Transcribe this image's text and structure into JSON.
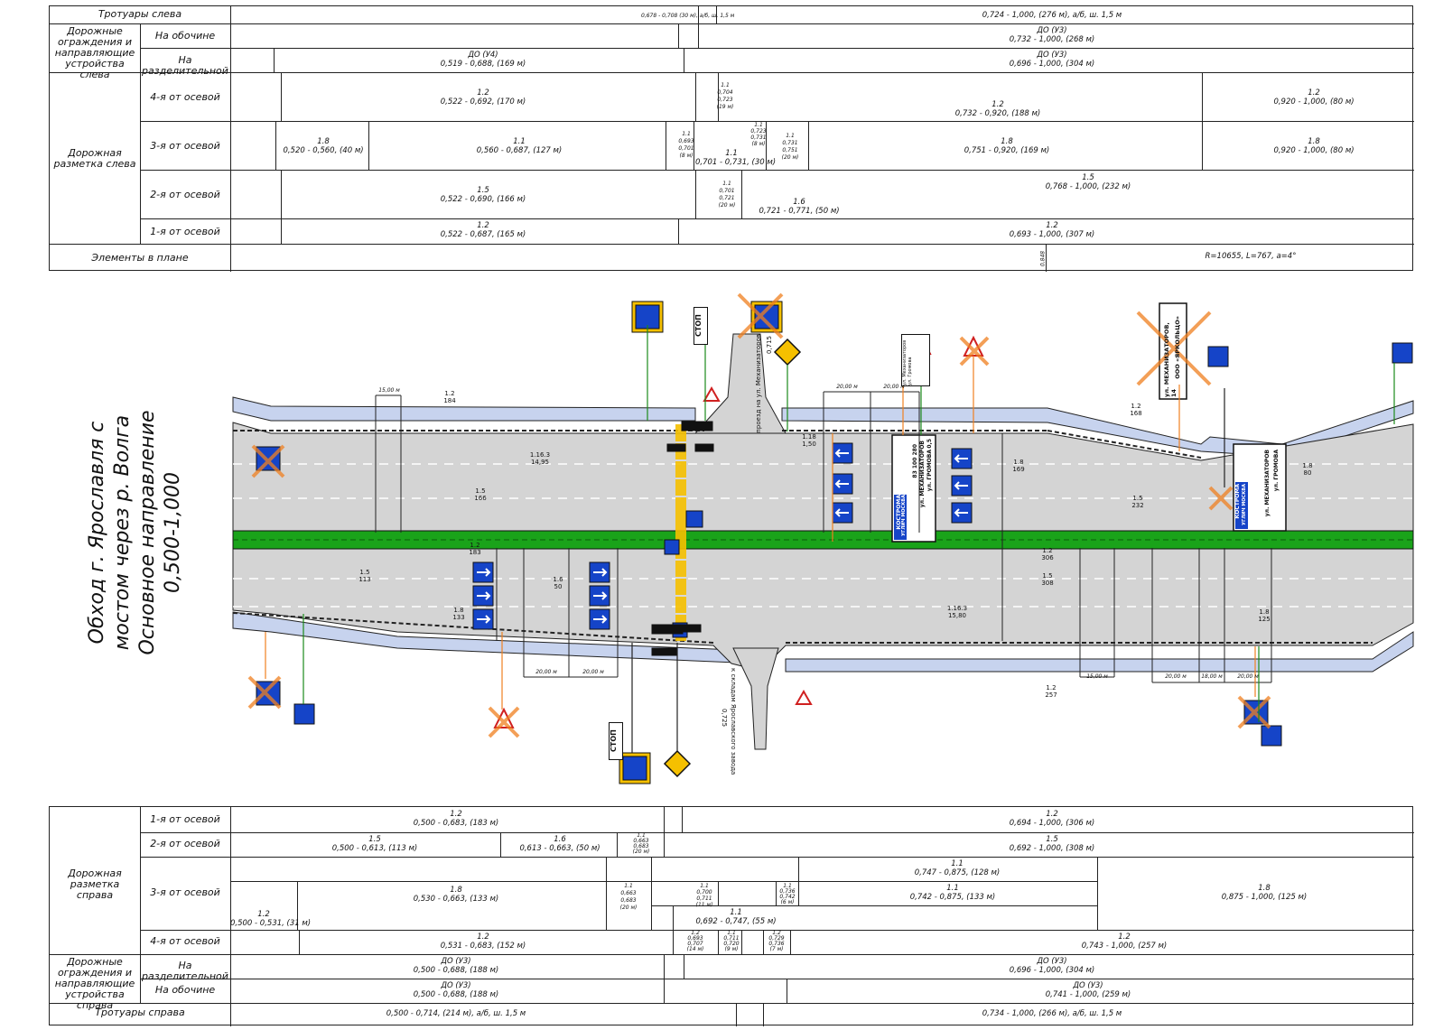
{
  "title": {
    "line1": "Обход г. Ярославля с мостом через р. Волга",
    "line2": "Основное направление",
    "line3": "0,500-1,000"
  },
  "top_table": {
    "sidewalks_left": "Тротуары слева",
    "barriers_left": "Дорожные ограждения и направляющие устройства слева",
    "shoulder": "На обочине",
    "median": "На разделительной",
    "marking_left": "Дорожная разметка слева",
    "lane4": "4-я от осевой",
    "lane3": "3-я от осевой",
    "lane2": "2-я от осевой",
    "lane1": "1-я от осевой",
    "plan_elements": "Элементы в плане",
    "sw_small": "0,678 - 0,708 (30 м), а/б, ш. 1,5 м",
    "sw_main": "0,724 - 1,000, (276 м), а/б, ш. 1,5 м",
    "sh_code": "ДО (У3)",
    "sh_val": "0,732 - 1,000, (268 м)",
    "md1_code": "ДО (У4)",
    "md1_val": "0,519 - 0,688, (169 м)",
    "md2_code": "ДО (У3)",
    "md2_val": "0,696 - 1,000, (304 м)",
    "l4a_code": "1.2",
    "l4a_val": "0,522 - 0,692, (170 м)",
    "l4b_code": "1.1",
    "l4b_v1": "0,704",
    "l4b_v2": "0,723",
    "l4b_v3": "(19 м)",
    "l4c_code": "1.2",
    "l4c_val": "0,732 - 0,920, (188 м)",
    "l4d_code": "1.2",
    "l4d_val": "0,920 - 1,000, (80 м)",
    "l3a_code": "1.8",
    "l3a_val": "0,520 - 0,560, (40 м)",
    "l3b_code": "1.1",
    "l3b_val": "0,560 - 0,687, (127 м)",
    "l3c_code": "1.1",
    "l3c_v1": "0,693",
    "l3c_v2": "0,701",
    "l3c_v3": "(8 м)",
    "l3d_code": "1.1",
    "l3d_val": "0,701 - 0,731, (30 м)",
    "l3e_code": "1.1",
    "l3e_v1": "0,723",
    "l3e_v2": "0,731",
    "l3e_v3": "(8 м)",
    "l3f_code": "1.1",
    "l3f_v1": "0,731",
    "l3f_v2": "0,751",
    "l3f_v3": "(20 м)",
    "l3g_code": "1.8",
    "l3g_val": "0,751 - 0,920, (169 м)",
    "l3h_code": "1.8",
    "l3h_val": "0,920 - 1,000, (80 м)",
    "l2a_code": "1.5",
    "l2a_val": "0,522 - 0,690, (166 м)",
    "l2b_code": "1.1",
    "l2b_v1": "0,701",
    "l2b_v2": "0,721",
    "l2b_v3": "(20 м)",
    "l2c_code": "1.6",
    "l2c_val": "0,721 - 0,771, (50 м)",
    "l2d_code": "1.5",
    "l2d_val": "0,768 - 1,000, (232 м)",
    "l1a_code": "1.2",
    "l1a_val": "0,522 - 0,687, (165 м)",
    "l1b_code": "1.2",
    "l1b_val": "0,693 - 1,000, (307 м)",
    "plan_val": "R=10655, L=767, а=4°",
    "plan_km": "0,848"
  },
  "bottom_table": {
    "marking_right": "Дорожная разметка справа",
    "lane1": "1-я от осевой",
    "lane2": "2-я от осевой",
    "lane3": "3-я от осевой",
    "lane4": "4-я от осевой",
    "barriers_right": "Дорожные ограждения и направляющие устройства справа",
    "median": "На разделительной",
    "shoulder": "На обочине",
    "sidewalks_right": "Тротуары справа",
    "r1a_code": "1.2",
    "r1a_val": "0,500 - 0,683, (183 м)",
    "r1b_code": "1.2",
    "r1b_val": "0,694 - 1,000, (306 м)",
    "r2a_code": "1.5",
    "r2a_val": "0,500 - 0,613, (113 м)",
    "r2b_code": "1.6",
    "r2b_val": "0,613 - 0,663, (50 м)",
    "r2c_code": "1.1",
    "r2c_v1": "0,663",
    "r2c_v2": "0,683",
    "r2c_v3": "(20 м)",
    "r2d_code": "1.5",
    "r2d_val": "0,692 - 1,000, (308 м)",
    "r3a_code": "1.8",
    "r3a_val": "0,530 - 0,663, (133 м)",
    "r3b_code": "1.2",
    "r3b_val": "0,500 - 0,531, (31 м)",
    "r3c_code": "1.1",
    "r3c_v1": "0,663",
    "r3c_v2": "0,683",
    "r3c_v3": "(20 м)",
    "r3d_code": "1.1",
    "r3d_v1": "0,700",
    "r3d_v2": "0,711",
    "r3d_v3": "(11 м)",
    "r3e_code": "1.1",
    "r3e_val": "0,692 - 0,747, (55 м)",
    "r3f_code": "1.1",
    "r3f_v1": "0,736",
    "r3f_v2": "0,742",
    "r3f_v3": "(6 м)",
    "r3g_code": "1.1",
    "r3g_val": "0,747 - 0,875, (128 м)",
    "r3h_code": "1.1",
    "r3h_val": "0,742 - 0,875, (133 м)",
    "r3i_code": "1.8",
    "r3i_val": "0,875 - 1,000, (125 м)",
    "r4a_code": "1.2",
    "r4a_val": "0,531 - 0,683, (152 м)",
    "r4b_code": "1.2",
    "r4b_v1": "0,693",
    "r4b_v2": "0,707",
    "r4b_v3": "(14 м)",
    "r4c_code": "1.1",
    "r4c_v1": "0,711",
    "r4c_v2": "0,720",
    "r4c_v3": "(9 м)",
    "r4d_code": "1.2",
    "r4d_v1": "0,729",
    "r4d_v2": "0,736",
    "r4d_v3": "(7 м)",
    "r4e_code": "1.2",
    "r4e_val": "0,743 - 1,000, (257 м)",
    "bm1_code": "ДО (У3)",
    "bm1_val": "0,500 - 0,688, (188 м)",
    "bm2_code": "ДО (У3)",
    "bm2_val": "0,696 - 1,000, (304 м)",
    "bs1_code": "ДО (У3)",
    "bs1_val": "0,500 - 0,688, (188 м)",
    "bs2_code": "ДО (У3)",
    "bs2_val": "0,741 - 1,000, (259 м)",
    "sw1": "0,500 - 0,714, (214 м), а/б, ш. 1,5 м",
    "sw2": "0,734 - 1,000, (266 м), а/б, ш. 1,5 м"
  },
  "plan": {
    "dist_15_left": "15,00 м",
    "dist_20a": "20,00 м",
    "dist_20b": "20,00 м",
    "dist_20c": "20,00 м",
    "dist_20d": "20,00 м",
    "dist_15_right": "15,00 м",
    "dist_20e": "20,00 м",
    "dist_18": "18,00 м",
    "dist_20f": "20,00 м",
    "stop1": "СТОП",
    "stop2": "СТОП",
    "road_top_label": "проезд на ул. Механизаторов",
    "road_top_km": "0,715",
    "road_bottom_label": "к складам Ярославского завода",
    "road_bottom_km": "0,725",
    "sign_big_1_a": "КОСТРОМА",
    "sign_big_1_b": "УГЛИЧ",
    "sign_big_1_c": "МОСКВА",
    "sign_big_1_d": "ул. МЕХАНИЗАТОРОВ",
    "sign_big_1_e": "ул. ГРОМОВА",
    "sign_big_1_n1": "83",
    "sign_big_1_n2": "100",
    "sign_big_1_n3": "280",
    "sign_big_1_n4": "0,5",
    "sign_big_2_a": "КОСТРОМА",
    "sign_big_2_b": "УГЛИЧ",
    "sign_big_2_c": "МОСКВА",
    "sign_big_2_d": "ул. МЕХАНИЗАТОРОВ",
    "sign_big_2_e": "ул. ГРОМОВА",
    "sign_top_right_a": "ул. МЕХАНИЗАТОРОВ, 14",
    "sign_top_right_b": "ООО «ЯРКОЛЬЦО»",
    "sign_ped_top": "ул. Механизаторов ул. Громова",
    "m_12_184": "1.2\n184",
    "marks": [
      {
        "t": "1.2",
        "b": "184"
      },
      {
        "t": "1.18",
        "b": "1,50"
      },
      {
        "t": "1.16.3",
        "b": "14,95"
      },
      {
        "t": "1.5",
        "b": "166"
      },
      {
        "t": "1.2",
        "b": "183"
      },
      {
        "t": "1.5",
        "b": "113"
      },
      {
        "t": "1.8",
        "b": "133"
      },
      {
        "t": "1.6",
        "b": "50"
      },
      {
        "t": "1.5",
        "b": "308"
      },
      {
        "t": "1.2",
        "b": "306"
      },
      {
        "t": "1.16.3",
        "b": "15,80"
      },
      {
        "t": "1.8",
        "b": "169"
      },
      {
        "t": "1.5",
        "b": "232"
      },
      {
        "t": "1.2",
        "b": "168"
      },
      {
        "t": "1.8",
        "b": "80"
      },
      {
        "t": "1.2",
        "b": "257"
      },
      {
        "t": "1.8",
        "b": "125"
      }
    ]
  },
  "colors": {
    "road": "#d4d4d4",
    "sidewalk": "#c7d3ee",
    "median": "#1aa31a",
    "sign_blue": "#1544c8",
    "sign_orange": "#f08020",
    "km_green": "#1a8a1a",
    "ped_yellow": "#f5c000"
  }
}
